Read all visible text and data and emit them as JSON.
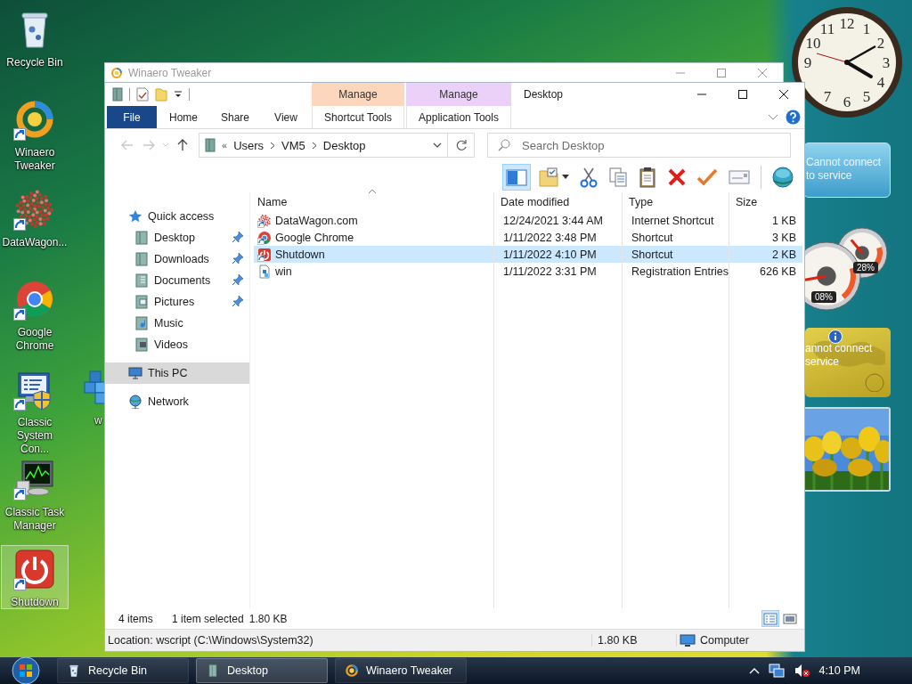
{
  "desktop_icons": [
    {
      "label": "Recycle Bin",
      "kind": "recycle",
      "shortcut": false,
      "selected": false
    },
    {
      "label": "Winaero Tweaker",
      "kind": "swirl",
      "shortcut": true,
      "selected": false
    },
    {
      "label": "DataWagon...",
      "kind": "dots",
      "shortcut": true,
      "selected": false
    },
    {
      "label": "Google Chrome",
      "kind": "browser",
      "shortcut": true,
      "selected": false
    },
    {
      "label": "Classic System Con...",
      "kind": "control",
      "shortcut": true,
      "selected": false
    },
    {
      "label": "Classic Task Manager",
      "kind": "taskmgr",
      "shortcut": true,
      "selected": false
    },
    {
      "label": "Shutdown",
      "kind": "power",
      "shortcut": true,
      "selected": true
    },
    {
      "label": "w",
      "kind": "registry",
      "shortcut": false,
      "selected": false
    }
  ],
  "back_window": {
    "title": "Winaero Tweaker"
  },
  "explorer": {
    "title": "Desktop",
    "ribbon_tabs": [
      {
        "label": "File",
        "kind": "file",
        "selected": false
      },
      {
        "label": "Home",
        "kind": "plain",
        "selected": false
      },
      {
        "label": "Share",
        "kind": "plain",
        "selected": false
      },
      {
        "label": "View",
        "kind": "plain",
        "selected": false
      },
      {
        "label": "Shortcut Tools",
        "kind": "context",
        "context": "Manage",
        "color": "#fcd7bd",
        "selected": false
      },
      {
        "label": "Application Tools",
        "kind": "context",
        "context": "Manage",
        "color": "#ebd1f7",
        "selected": false
      }
    ],
    "address": {
      "overflow": "«",
      "crumbs": [
        "Users",
        "VM5",
        "Desktop"
      ]
    },
    "search": {
      "placeholder": "Search Desktop"
    },
    "toolbar_buttons": [
      {
        "kind": "preview-pane",
        "selected": true
      },
      {
        "kind": "folder-options",
        "selected": false
      },
      {
        "kind": "cut",
        "selected": false
      },
      {
        "kind": "copy",
        "selected": false
      },
      {
        "kind": "paste",
        "selected": false
      },
      {
        "kind": "delete",
        "selected": false
      },
      {
        "kind": "check",
        "selected": false
      },
      {
        "kind": "rename",
        "selected": false
      },
      {
        "kind": "globe",
        "selected": false
      }
    ],
    "navigation": [
      {
        "label": "Quick access",
        "kind": "star",
        "pinned": false,
        "selected": false,
        "children": [
          {
            "label": "Desktop",
            "kind": "folder",
            "pinned": true,
            "selected": false
          },
          {
            "label": "Downloads",
            "kind": "folder",
            "pinned": true,
            "selected": false
          },
          {
            "label": "Documents",
            "kind": "documents",
            "pinned": true,
            "selected": false
          },
          {
            "label": "Pictures",
            "kind": "pictures",
            "pinned": true,
            "selected": false
          },
          {
            "label": "Music",
            "kind": "music",
            "pinned": false,
            "selected": false
          },
          {
            "label": "Videos",
            "kind": "videos",
            "pinned": false,
            "selected": false
          }
        ]
      },
      {
        "label": "This PC",
        "kind": "pc",
        "pinned": false,
        "selected": true
      },
      {
        "label": "Network",
        "kind": "network",
        "pinned": false,
        "selected": false
      }
    ],
    "columns": [
      {
        "label": "Name",
        "sorted": true
      },
      {
        "label": "Date modified",
        "sorted": false
      },
      {
        "label": "Type",
        "sorted": false
      },
      {
        "label": "Size",
        "sorted": false
      }
    ],
    "files": [
      {
        "name": "DataWagon.com",
        "date": "12/24/2021 3:44 AM",
        "type": "Internet Shortcut",
        "size": "1 KB",
        "kind": "dots",
        "selected": false
      },
      {
        "name": "Google Chrome",
        "date": "1/11/2022 3:48 PM",
        "type": "Shortcut",
        "size": "3 KB",
        "kind": "browser",
        "selected": false
      },
      {
        "name": "Shutdown",
        "date": "1/11/2022 4:10 PM",
        "type": "Shortcut",
        "size": "2 KB",
        "kind": "power",
        "selected": true
      },
      {
        "name": "win",
        "date": "1/11/2022 3:31 PM",
        "type": "Registration Entries",
        "size": "626 KB",
        "kind": "registry",
        "selected": false
      }
    ],
    "status": {
      "count": "4 items",
      "selection": "1 item selected",
      "selection_size": "1.80 KB"
    },
    "view_buttons": [
      {
        "kind": "details",
        "selected": true
      },
      {
        "kind": "large-icons",
        "selected": false
      }
    ],
    "location_bar": {
      "location": "Location: wscript (C:\\Windows\\System32)",
      "size": "1.80 KB",
      "zone": "Computer"
    }
  },
  "gadgets": {
    "clock_numerals": [
      "12",
      "11",
      "1",
      "10",
      "2",
      "9",
      "3",
      "4",
      "7",
      "5",
      "6"
    ],
    "weather": {
      "message": "Cannot connect to service"
    },
    "cpu_meter": [
      {
        "reading": "08%"
      },
      {
        "reading": "28%"
      }
    ],
    "currency": {
      "lines": [
        "annot connect",
        "service"
      ]
    }
  },
  "taskbar": {
    "buttons": [
      {
        "label": "Recycle Bin",
        "kind": "recycle",
        "selected": false
      },
      {
        "label": "Desktop",
        "kind": "folder",
        "selected": true
      },
      {
        "label": "Winaero Tweaker",
        "kind": "swirl",
        "selected": false
      }
    ],
    "clock": "4:10 PM",
    "volume_muted": true
  }
}
